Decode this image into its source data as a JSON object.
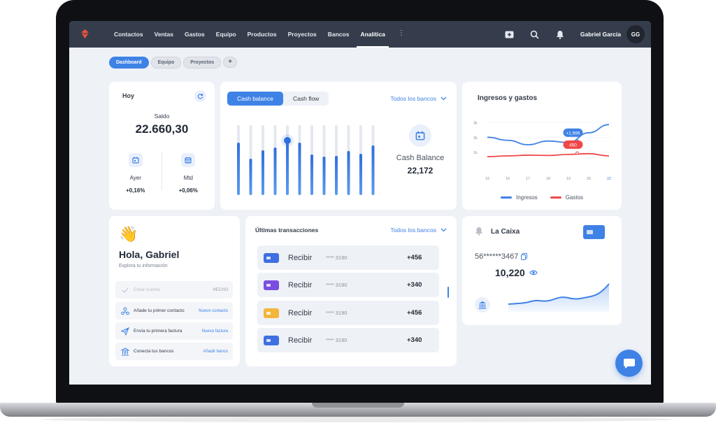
{
  "topbar": {
    "nav": [
      "Contactos",
      "Ventas",
      "Gastos",
      "Equipo",
      "Productos",
      "Proyectos",
      "Bancos",
      "Analítica"
    ],
    "active": "Analítica",
    "more": "⋮",
    "user_name": "Gabriel García",
    "avatar_initials": "GG"
  },
  "tabs": [
    "Dashboard",
    "Equipo",
    "Proyectos"
  ],
  "tab_add": "+",
  "today": {
    "title": "Hoy",
    "saldo_label": "Saldo",
    "saldo_value": "22.660,30",
    "ayer_label": "Ayer",
    "ayer_value": "+0,16%",
    "mtd_label": "Mtd",
    "mtd_value": "+0,06%"
  },
  "cash": {
    "tab_balance": "Cash balance",
    "tab_flow": "Cash flow",
    "bank_select": "Todos los bancos",
    "label": "Cash Balance",
    "value": "22,172",
    "bars": [
      0.75,
      0.52,
      0.64,
      0.68,
      0.78,
      0.75,
      0.58,
      0.55,
      0.56,
      0.63,
      0.59,
      0.71
    ]
  },
  "chart_data": {
    "type": "line",
    "title": "Ingresos y gastos",
    "x": [
      15,
      16,
      17,
      18,
      19,
      20,
      22
    ],
    "yticks": [
      "3k",
      "2k",
      "1k"
    ],
    "series": [
      {
        "name": "Ingresos",
        "values": [
          2000,
          1800,
          1500,
          1750,
          1650,
          2300,
          2850
        ],
        "color": "#3f82e6"
      },
      {
        "name": "Gastos",
        "values": [
          700,
          750,
          800,
          780,
          850,
          900,
          750
        ],
        "color": "#f04848"
      }
    ],
    "annotations": [
      "+1,999",
      "450"
    ]
  },
  "welcome": {
    "emoji": "👋",
    "greeting": "Hola, Gabriel",
    "subtitle": "Explora tu información",
    "tasks": [
      {
        "label": "Crear cuenta",
        "action": "HECHO",
        "done": true
      },
      {
        "label": "Añade tu primer contacto",
        "action": "Nuevo contacto"
      },
      {
        "label": "Envía tu primera factura",
        "action": "Nueva factura"
      },
      {
        "label": "Conecta tus bancos",
        "action": "Añadir banco"
      }
    ]
  },
  "transactions": {
    "title": "Últimas transacciones",
    "bank_select": "Todos los bancos",
    "rows": [
      {
        "name": "Recibir",
        "number": "**** 3190",
        "amount": "+456",
        "color": "#3f6fe0"
      },
      {
        "name": "Recibir",
        "number": "**** 3190",
        "amount": "+340",
        "color": "#7a4de0"
      },
      {
        "name": "Recibir",
        "number": "**** 3190",
        "amount": "+456",
        "color": "#f3b63a"
      },
      {
        "name": "Recibir",
        "number": "**** 3190",
        "amount": "+340",
        "color": "#3f6fe0"
      }
    ]
  },
  "bank": {
    "name": "La Caixa",
    "account": "56******3467",
    "balance": "10,220"
  }
}
